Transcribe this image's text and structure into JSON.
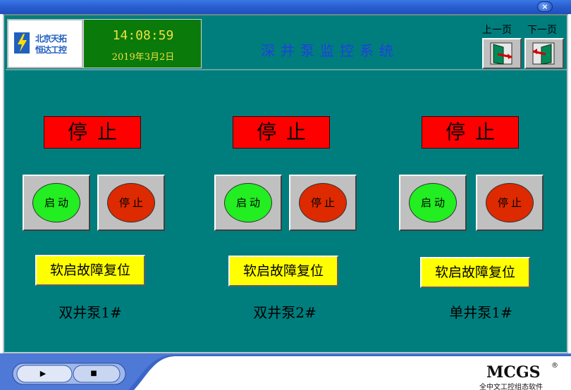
{
  "window": {
    "close_glyph": "×"
  },
  "header": {
    "logo_line1": "北京天拓",
    "logo_line2": "恒达工控",
    "time": "14:08:59",
    "date": "2019年3月2日",
    "system_title": "深井泵监控系统",
    "nav_prev_label": "上一页",
    "nav_next_label": "下一页"
  },
  "pumps": [
    {
      "name": "双井泵1#",
      "status": "停止",
      "start_label": "启动",
      "stop_label": "停止",
      "reset_label": "软启故障复位"
    },
    {
      "name": "双井泵2#",
      "status": "停止",
      "start_label": "启动",
      "stop_label": "停止",
      "reset_label": "软启故障复位"
    },
    {
      "name": "单井泵1#",
      "status": "停止",
      "start_label": "启动",
      "stop_label": "停止",
      "reset_label": "软启故障复位"
    }
  ],
  "footer": {
    "play_glyph": "▶",
    "stop_glyph": "■",
    "brand": "MCGS",
    "brand_reg": "®",
    "brand_sub": "全中文工控组态软件"
  },
  "colors": {
    "panel_bg": "#007e7e",
    "status_red": "#ff0000",
    "start_green": "#22ee22",
    "stop_red": "#dd2a00",
    "reset_yellow": "#ffff00",
    "clock_bg": "#0a7a0a",
    "clock_text": "#f0e040",
    "title_blue": "#2040e0"
  }
}
